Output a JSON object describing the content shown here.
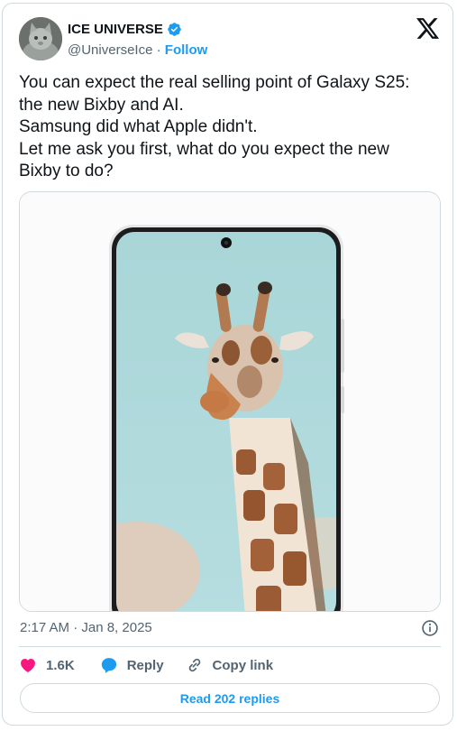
{
  "author": {
    "name": "ICE UNIVERSE",
    "handle": "@UniverseIce",
    "separator": "·",
    "follow_label": "Follow"
  },
  "tweet": {
    "lines": [
      "You can expect the real selling point of Galaxy S25:",
      "the new Bixby and AI.",
      "Samsung did what Apple didn't.",
      "Let me ask you first, what do you expect the new",
      "Bixby to do?"
    ],
    "timestamp": "2:17 AM · Jan 8, 2025"
  },
  "media": {
    "description_icon": "phone-with-giraffe-wallpaper"
  },
  "actions": {
    "like_count": "1.6K",
    "reply_label": "Reply",
    "copy_label": "Copy link"
  },
  "footer": {
    "read_replies_label": "Read 202 replies"
  },
  "colors": {
    "accent": "#1d9bf0",
    "like": "#f91880",
    "text": "#0f1419",
    "muted": "#536471",
    "border": "#cfd9de"
  }
}
